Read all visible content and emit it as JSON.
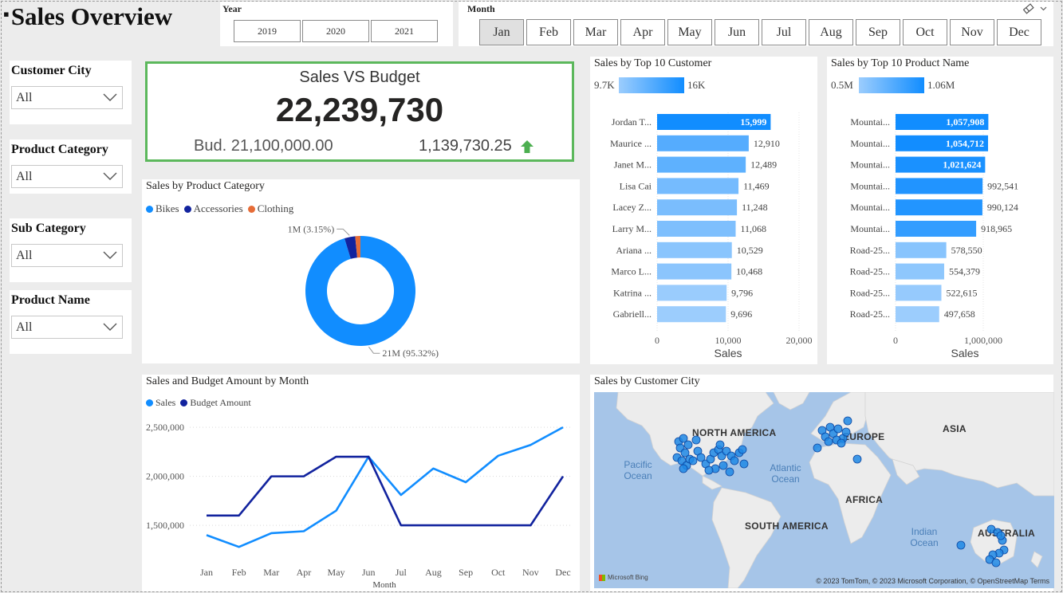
{
  "header": {
    "title": "Sales Overview"
  },
  "year_slicer": {
    "label": "Year",
    "options": [
      "2019",
      "2020",
      "2021"
    ]
  },
  "month_slicer": {
    "label": "Month",
    "options": [
      "Jan",
      "Feb",
      "Mar",
      "Apr",
      "May",
      "Jun",
      "Jul",
      "Aug",
      "Sep",
      "Oct",
      "Nov",
      "Dec"
    ],
    "selected": "Jan"
  },
  "filters": [
    {
      "label": "Customer City",
      "value": "All"
    },
    {
      "label": "Product Category",
      "value": "All"
    },
    {
      "label": "Sub Category",
      "value": "All"
    },
    {
      "label": "Product Name",
      "value": "All"
    }
  ],
  "kpi": {
    "title": "Sales VS Budget",
    "value": "22,239,730",
    "budget": "Bud. 21,100,000.00",
    "difference": "1,139,730.25",
    "trend": "up",
    "trend_color": "#4caf50"
  },
  "icons": {
    "eraser": "eraser-icon",
    "chevron": "chevron-down-icon",
    "trend": "arrow-up-icon"
  },
  "colors": {
    "primary": "#118dff",
    "dark": "#12239e",
    "orange": "#e66c37",
    "light": "#9ccdfd"
  },
  "chart_data": [
    {
      "type": "pie",
      "title": "Sales by Product Category",
      "categories": [
        "Bikes",
        "Accessories",
        "Clothing"
      ],
      "values": [
        95.32,
        3.15,
        1.53
      ],
      "labels": [
        "21M (95.32%)",
        "1M (3.15%)"
      ],
      "colors": [
        "#118dff",
        "#12239e",
        "#e66c37"
      ]
    },
    {
      "type": "bar",
      "title": "Sales by Top 10 Customer",
      "categories": [
        "Jordan T...",
        "Maurice ...",
        "Janet M...",
        "Lisa Cai",
        "Lacey Z...",
        "Larry M...",
        "Ariana ...",
        "Marco L...",
        "Katrina ...",
        "Gabriell..."
      ],
      "values": [
        15999,
        12910,
        12489,
        11469,
        11248,
        11068,
        10529,
        10468,
        9796,
        9696
      ],
      "value_labels": [
        "15,999",
        "12,910",
        "12,489",
        "11,469",
        "11,248",
        "11,068",
        "10,529",
        "10,468",
        "9,796",
        "9,696"
      ],
      "xlabel": "Sales",
      "ticks": [
        "0",
        "10,000",
        "20,000"
      ],
      "xlim": [
        0,
        20000
      ],
      "gradient_legend": [
        "9.7K",
        "16K"
      ]
    },
    {
      "type": "bar",
      "title": "Sales by Top 10 Product Name",
      "categories": [
        "Mountai...",
        "Mountai...",
        "Mountai...",
        "Mountai...",
        "Mountai...",
        "Mountai...",
        "Road-25...",
        "Road-25...",
        "Road-25...",
        "Road-25..."
      ],
      "values": [
        1057908,
        1054712,
        1021624,
        992541,
        990124,
        918965,
        578550,
        554379,
        522615,
        497658
      ],
      "value_labels": [
        "1,057,908",
        "1,054,712",
        "1,021,624",
        "992,541",
        "990,124",
        "918,965",
        "578,550",
        "554,379",
        "522,615",
        "497,658"
      ],
      "xlabel": "Sales",
      "ticks": [
        "0",
        "1,000,000"
      ],
      "xlim": [
        0,
        1800000
      ],
      "gradient_legend": [
        "0.5M",
        "1.06M"
      ]
    },
    {
      "type": "line",
      "title": "Sales and Budget Amount by Month",
      "xlabel": "Month",
      "categories": [
        "Jan",
        "Feb",
        "Mar",
        "Apr",
        "May",
        "Jun",
        "Jul",
        "Aug",
        "Sep",
        "Oct",
        "Nov",
        "Dec"
      ],
      "series": [
        {
          "name": "Sales",
          "color": "#118dff",
          "values": [
            1400000,
            1280000,
            1420000,
            1440000,
            1650000,
            2200000,
            1810000,
            2080000,
            1940000,
            2210000,
            2320000,
            2500000
          ]
        },
        {
          "name": "Budget Amount",
          "color": "#12239e",
          "values": [
            1600000,
            1600000,
            2000000,
            2000000,
            2200000,
            2200000,
            1500000,
            1500000,
            1500000,
            1500000,
            1500000,
            2000000
          ]
        }
      ],
      "ticks": [
        "1,500,000",
        "2,000,000",
        "2,500,000"
      ],
      "ylim": [
        1200000,
        2550000
      ]
    }
  ],
  "map": {
    "title": "Sales by Customer City",
    "labels": [
      "NORTH AMERICA",
      "EUROPE",
      "ASIA",
      "AFRICA",
      "SOUTH AMERICA",
      "AUSTRALIA"
    ],
    "oceans": [
      "Pacific Ocean",
      "Atlantic Ocean",
      "Indian Ocean"
    ],
    "credit": "© 2023 TomTom, © 2023 Microsoft Corporation, © OpenStreetMap  Terms",
    "bing": "Microsoft Bing"
  }
}
